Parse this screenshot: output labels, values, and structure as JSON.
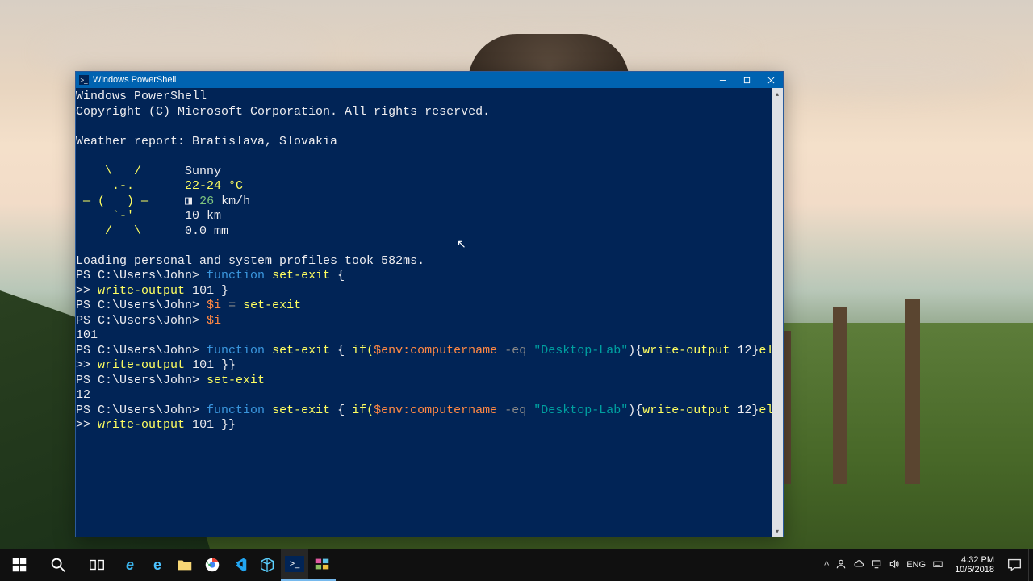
{
  "window": {
    "title": "Windows PowerShell",
    "icon": "powershell-icon"
  },
  "terminal": {
    "header1": "Windows PowerShell",
    "header2": "Copyright (C) Microsoft Corporation. All rights reserved.",
    "weather_title": "Weather report: Bratislava, Slovakia",
    "weather": {
      "art1": "    \\   /    ",
      "cond": "Sunny",
      "art2": "     .-.     ",
      "temp": "22-24 °C",
      "art3": " ― (   ) ―   ",
      "wind_glyph": "◨",
      "wind_val": "26",
      "wind_unit": " km/h",
      "art4": "     `-'     ",
      "vis": "10 km",
      "art5": "    /   \\    ",
      "precip": "0.0 mm"
    },
    "profiles": "Loading personal and system profiles took 582ms.",
    "prompt": "PS C:\\Users\\John>",
    "cont": ">>",
    "out101": "101",
    "out12": "12",
    "tok": {
      "function": "function",
      "setexit": "set-exit",
      "obrace": "{",
      "cbrace": "}",
      "cbrace2": "}}",
      "writeoutput": "write-output",
      "n101": "101",
      "n12": "12",
      "var_i": "$i",
      "eq": "=",
      "if": "if(",
      "envvar": "$env:computername",
      "op": "-eq",
      "str": "\"Desktop-Lab\"",
      "rparen": ")",
      "else": "else",
      "obrace2": "{"
    }
  },
  "taskbar": {
    "items": [
      {
        "name": "start",
        "icon": "windows-icon"
      },
      {
        "name": "search",
        "icon": "search-icon"
      },
      {
        "name": "taskview",
        "icon": "taskview-icon"
      },
      {
        "name": "ie",
        "icon": "ie-icon"
      },
      {
        "name": "edge",
        "icon": "edge-icon"
      },
      {
        "name": "explorer",
        "icon": "folder-icon"
      },
      {
        "name": "chrome",
        "icon": "chrome-icon"
      },
      {
        "name": "vscode",
        "icon": "vscode-icon"
      },
      {
        "name": "box",
        "icon": "cube-icon"
      },
      {
        "name": "powershell",
        "icon": "powershell-icon"
      },
      {
        "name": "app",
        "icon": "colorgrid-icon"
      }
    ],
    "tray": {
      "chevron": "^",
      "people": "people-icon",
      "onedrive": "cloud-icon",
      "net": "monitor-icon",
      "vol": "speaker-icon",
      "lang": "ENG",
      "kbd": "keyboard-icon"
    },
    "clock": {
      "time": "4:32 PM",
      "date": "10/6/2018"
    }
  }
}
